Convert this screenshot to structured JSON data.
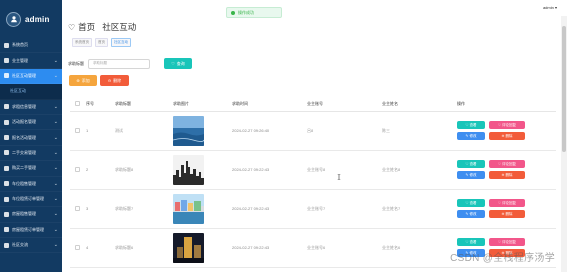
{
  "app": {
    "brand": "admin",
    "user": "admin"
  },
  "toast": {
    "text": "操作成功"
  },
  "sidebar": {
    "items": [
      {
        "label": "系统首页",
        "chevron": ""
      },
      {
        "label": "业主管理",
        "chevron": "⌄"
      },
      {
        "label": "社区互动管理",
        "chevron": "⌄",
        "active": true
      },
      {
        "label": "社区互动",
        "chevron": "",
        "sub": true
      },
      {
        "label": "求租信息管理",
        "chevron": "⌄"
      },
      {
        "label": "活动报名管理",
        "chevron": "⌄"
      },
      {
        "label": "报名活动管理",
        "chevron": "⌄"
      },
      {
        "label": "二手交易管理",
        "chevron": "⌄"
      },
      {
        "label": "购买二手管理",
        "chevron": "⌄"
      },
      {
        "label": "车位租售管理",
        "chevron": "⌄"
      },
      {
        "label": "车位租赁订单管理",
        "chevron": "⌄"
      },
      {
        "label": "房屋租售管理",
        "chevron": "⌄"
      },
      {
        "label": "房屋租赁订单管理",
        "chevron": "⌄"
      },
      {
        "label": "社区交流",
        "chevron": "⌄"
      }
    ]
  },
  "page": {
    "title": "首页",
    "subtitle": "社区互动",
    "breadcrumbs": [
      "系统首页",
      "首页",
      "社区互动"
    ]
  },
  "search": {
    "label": "求助标题",
    "placeholder": "求助标题",
    "query_label": "查询"
  },
  "actions": {
    "add_label": "添加",
    "delete_label": "删除"
  },
  "table": {
    "headers": [
      "",
      "序号",
      "求助标题",
      "求助图片",
      "求助时间",
      "业主账号",
      "业主姓名",
      "操作"
    ],
    "rows": [
      {
        "index": "1",
        "title": "测试",
        "time": "2024-02-27 09:26:40",
        "account": "吕8",
        "name": "陈三",
        "image": "ocean"
      },
      {
        "index": "2",
        "title": "求助标题8",
        "time": "2024-02-27 09:22:43",
        "account": "业主账号8",
        "name": "业主姓名8",
        "image": "skyline"
      },
      {
        "index": "3",
        "title": "求助标题7",
        "time": "2024-02-27 09:22:43",
        "account": "业主账号7",
        "name": "业主姓名7",
        "image": "waterfront"
      },
      {
        "index": "4",
        "title": "求助标题6",
        "time": "2024-02-27 09:22:43",
        "account": "业主账号6",
        "name": "业主姓名6",
        "image": "night"
      }
    ],
    "op_labels": {
      "view": "查看",
      "reply": "评论回复",
      "edit": "修改",
      "delete": "删除"
    }
  },
  "watermark": "CSDN @全栈程序汤学",
  "colors": {
    "sidebar": "#123a62",
    "active": "#2d8cf0",
    "teal": "#19c5b9",
    "orange": "#f5a53d",
    "red": "#f25c3a",
    "pink": "#f2568a",
    "blue": "#3e8ef0"
  }
}
